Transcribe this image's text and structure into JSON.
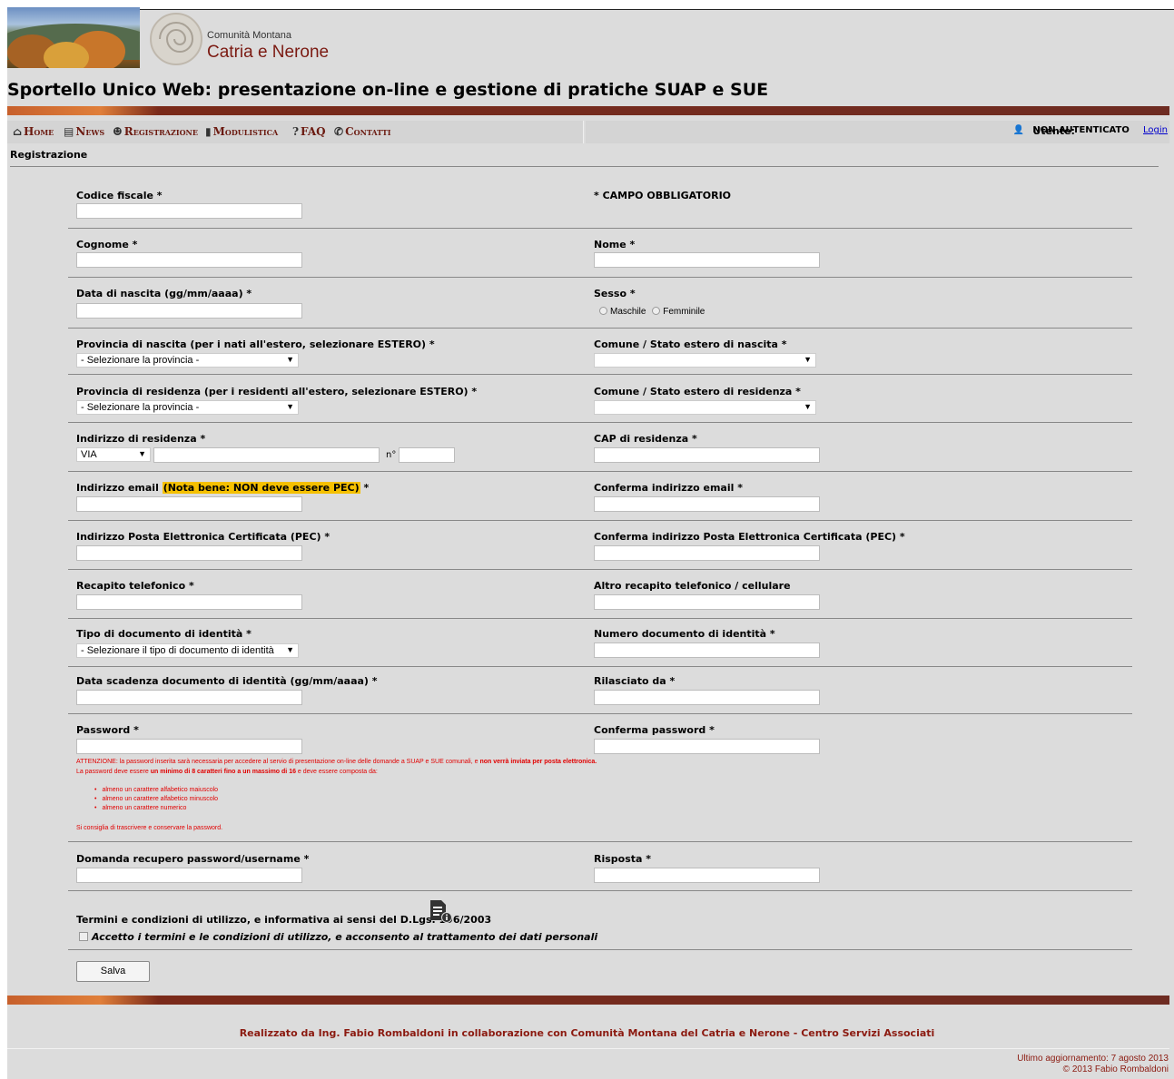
{
  "header": {
    "org_small": "Comunità Montana",
    "org_big": "Catria e Nerone",
    "site_title": "Sportello Unico Web: presentazione on-line e gestione di pratiche SUAP e SUE"
  },
  "nav": {
    "items": [
      {
        "label": "Home",
        "icon": "home-icon"
      },
      {
        "label": "News",
        "icon": "news-icon"
      },
      {
        "label": "Registrazione",
        "icon": "users-icon"
      },
      {
        "label": "Modulistica",
        "icon": "document-icon"
      },
      {
        "label": "FAQ",
        "icon": "question-icon"
      },
      {
        "label": "Contatti",
        "icon": "phone-icon"
      }
    ],
    "user_label": "Utente:",
    "user_value": "NON AUTENTICATO",
    "login": "Login"
  },
  "breadcrumb": "Registrazione",
  "form": {
    "codice_fiscale": "Codice fiscale *",
    "campo_obbligatorio": "* CAMPO OBBLIGATORIO",
    "cognome": "Cognome *",
    "nome": "Nome *",
    "data_nascita": "Data di nascita (gg/mm/aaaa) *",
    "sesso": "Sesso *",
    "sesso_m": "Maschile",
    "sesso_f": "Femminile",
    "prov_nascita": "Provincia di nascita (per i nati all'estero, selezionare ESTERO)  *",
    "prov_nascita_value": "- Selezionare la provincia -",
    "comune_nascita": "Comune / Stato estero di nascita *",
    "comune_nascita_value": "",
    "prov_residenza": "Provincia di residenza (per i residenti all'estero, selezionare ESTERO)  *",
    "prov_residenza_value": "- Selezionare la provincia -",
    "comune_residenza": "Comune / Stato estero di residenza *",
    "comune_residenza_value": "",
    "indirizzo": "Indirizzo di residenza *",
    "via_value": "VIA",
    "numero_label": "n°",
    "cap": "CAP di residenza *",
    "email": "Indirizzo email",
    "email_note": "(Nota bene: NON deve essere PEC)",
    "email_star": "*",
    "conferma_email": "Conferma indirizzo email *",
    "pec": "Indirizzo Posta Elettronica Certificata (PEC) *",
    "conferma_pec": "Conferma indirizzo Posta Elettronica Certificata (PEC) *",
    "telefono": "Recapito telefonico *",
    "altro_telefono": "Altro recapito telefonico / cellulare",
    "tipo_doc": "Tipo di documento di identità *",
    "tipo_doc_value": "- Selezionare il tipo di documento di identità",
    "numero_doc": "Numero documento di identità *",
    "scadenza_doc": "Data scadenza documento di identità (gg/mm/aaaa) *",
    "rilasciato": "Rilasciato da *",
    "password": "Password *",
    "conferma_password": "Conferma password *",
    "warn1a": "ATTENZIONE: la password inserita sarà necessaria per accedere al servio di presentazione on-line delle domande a SUAP e SUE comunali, e ",
    "warn1b": "non verrà inviata per posta elettronica.",
    "warn2a": "La password deve essere ",
    "warn2b": "un minimo di 8 caratteri fino a un massimo di 16",
    "warn2c": " e deve essere composta da:",
    "rules": [
      "almeno un carattere alfabetico maiuscolo",
      "almeno un carattere alfabetico minuscolo",
      "almeno un carattere numerico"
    ],
    "warn3": "Si consiglia di trascrivere e conservare la password.",
    "domanda": "Domanda recupero password/username *",
    "risposta": "Risposta *",
    "termini": "Termini e condizioni di utilizzo, e informativa ai sensi del D.Lgs. 196/2003",
    "accetto": "Accetto i termini e le condizioni di utilizzo, e acconsento al trattamento dei dati personali",
    "salva": "Salva"
  },
  "footer": {
    "credit": "Realizzato da Ing. Fabio Rombaldoni in collaborazione con Comunità Montana del Catria e Nerone - Centro Servizi Associati",
    "updated": "Ultimo aggiornamento: 7 agosto 2013",
    "copyright": "© 2013 Fabio Rombaldoni"
  },
  "colors": {
    "accent": "#7b1a12",
    "band_orange": "#e07f3a",
    "band_dark": "#6e2c22",
    "highlight": "#f5c000",
    "warning": "#e10000"
  }
}
